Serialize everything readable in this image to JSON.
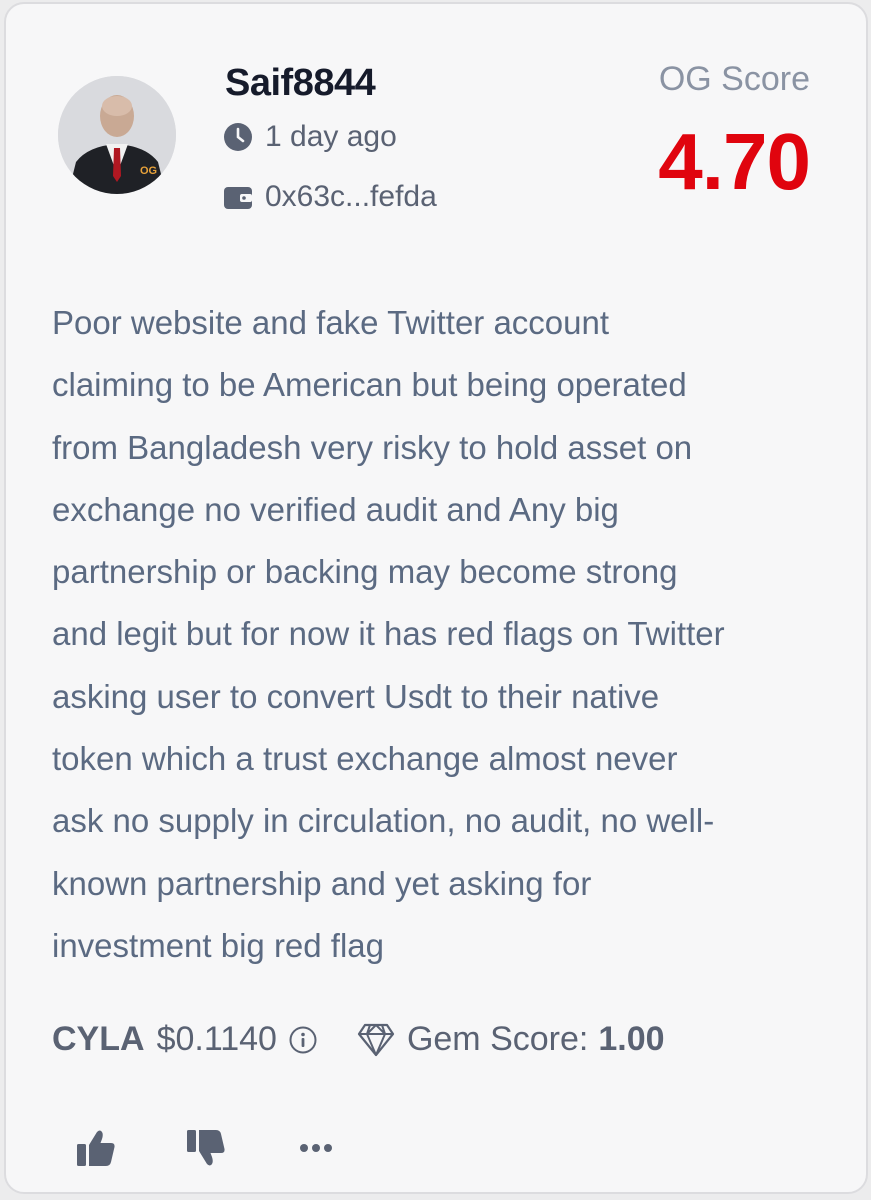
{
  "review_card": {
    "author": {
      "username": "Saif8844",
      "time_ago": "1 day ago",
      "wallet": "0x63c...fefda",
      "avatar_badge": "OG"
    },
    "og_score": {
      "label": "OG Score",
      "value": "4.70",
      "color": "#e0040e"
    },
    "review_lines": [
      "Poor website and fake Twitter account",
      "claiming to be American but being operated",
      "from Bangladesh very risky to hold asset on",
      "exchange no verified audit and Any big",
      "partnership or backing may become strong",
      "and legit but for now it has red flags on Twitter",
      "asking user to convert Usdt to their native",
      "token which a trust exchange almost never",
      "ask no supply in circulation, no audit, no well-",
      "known partnership and yet asking for",
      "investment big red flag"
    ],
    "token": {
      "ticker": "CYLA",
      "price": "$0.1140",
      "gem_label": "Gem Score:",
      "gem_value": "1.00"
    },
    "icons": {
      "clock": "clock-icon",
      "wallet": "wallet-icon",
      "info": "info-icon",
      "gem": "diamond-icon",
      "like": "thumbs-up-icon",
      "dislike": "thumbs-down-icon",
      "more": "more-icon"
    }
  }
}
